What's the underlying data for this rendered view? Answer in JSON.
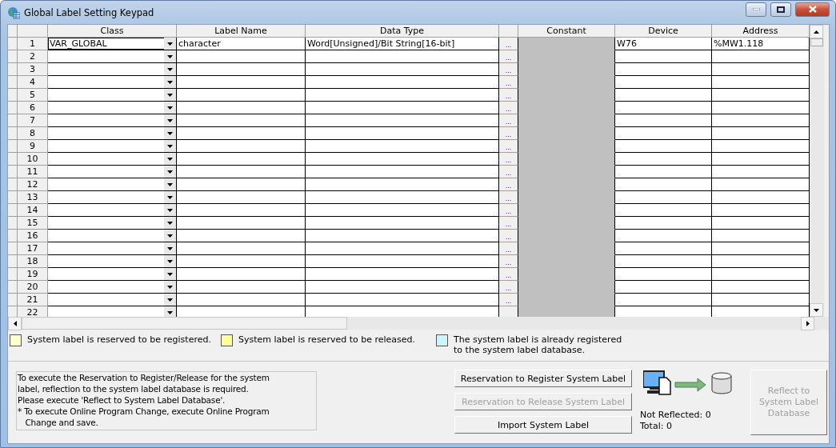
{
  "window": {
    "title": "Global Label Setting Keypad"
  },
  "columns": [
    "Class",
    "Label Name",
    "Data Type",
    "Constant",
    "Device",
    "Address"
  ],
  "rows": [
    {
      "number": "1",
      "class": "VAR_GLOBAL",
      "label_name": "character",
      "data_type": "Word[Unsigned]/Bit String[16-bit]",
      "browse": "...",
      "device": "W76",
      "address": "%MW1.118",
      "selected": true
    },
    {
      "number": "2",
      "browse": "...",
      "selected": false
    },
    {
      "number": "3",
      "browse": "...",
      "selected": false
    },
    {
      "number": "4",
      "browse": "...",
      "selected": false
    },
    {
      "number": "5",
      "browse": "...",
      "selected": false
    },
    {
      "number": "6",
      "browse": "...",
      "selected": false
    },
    {
      "number": "7",
      "browse": "...",
      "selected": false
    },
    {
      "number": "8",
      "browse": "...",
      "selected": false
    },
    {
      "number": "9",
      "browse": "...",
      "selected": false
    },
    {
      "number": "10",
      "browse": "...",
      "selected": false
    },
    {
      "number": "11",
      "browse": "...",
      "selected": false
    },
    {
      "number": "12",
      "browse": "...",
      "selected": false
    },
    {
      "number": "13",
      "browse": "...",
      "selected": false
    },
    {
      "number": "14",
      "browse": "...",
      "selected": false
    },
    {
      "number": "15",
      "browse": "...",
      "selected": false
    },
    {
      "number": "16",
      "browse": "...",
      "selected": false
    },
    {
      "number": "17",
      "browse": "...",
      "selected": false
    },
    {
      "number": "18",
      "browse": "...",
      "selected": false
    },
    {
      "number": "19",
      "browse": "...",
      "selected": false
    },
    {
      "number": "20",
      "browse": "...",
      "selected": false
    },
    {
      "number": "21",
      "browse": "...",
      "selected": false
    },
    {
      "number": "22",
      "selected": false
    }
  ],
  "legend": [
    {
      "text": "System label is reserved to be registered.",
      "color": "#ffffcc"
    },
    {
      "text": "System label is reserved to be released.",
      "color": "#ffff99"
    },
    {
      "text": "The system label is already registered\nto the system label database.",
      "color": "#ccf5ff"
    }
  ],
  "info_text": "To execute the Reservation to Register/Release for the system\nlabel, reflection to the system label database is required.\nPlease execute 'Reflect to System Label Database'.\n* To execute Online Program Change, execute Online Program\n   Change and save.",
  "buttons": [
    {
      "label": "Reservation to Register System Label",
      "disabled": false
    },
    {
      "label": "Reservation to Release System Label",
      "disabled": true
    },
    {
      "label": "Import System Label",
      "disabled": false
    }
  ],
  "status": {
    "not_reflected": "Not Reflected: 0",
    "total": "Total: 0"
  },
  "reflect_button": {
    "label": "Reflect to\nSystem Label\nDatabase",
    "disabled": true
  }
}
